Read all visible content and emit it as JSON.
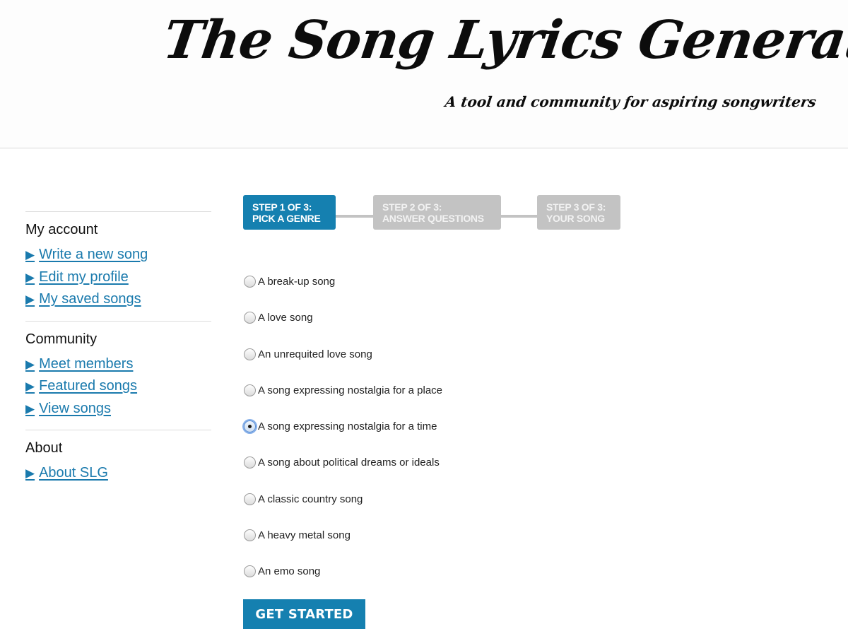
{
  "header": {
    "title": "The Song Lyrics Generator",
    "tagline": "A tool and community for aspiring songwriters"
  },
  "sidebar": {
    "link_icon": "▶",
    "sections": [
      {
        "heading": "My account",
        "links": [
          "Write a new song",
          "Edit my profile",
          "My saved songs"
        ]
      },
      {
        "heading": "Community",
        "links": [
          "Meet members",
          "Featured songs",
          "View songs"
        ]
      },
      {
        "heading": "About",
        "links": [
          "About SLG"
        ]
      }
    ]
  },
  "steps": [
    {
      "line1": "STEP 1 OF 3:",
      "line2": "PICK A GENRE",
      "active": true
    },
    {
      "line1": "STEP 2 OF 3:",
      "line2": "ANSWER QUESTIONS",
      "active": false
    },
    {
      "line1": "STEP 3 OF 3:",
      "line2": "YOUR SONG",
      "active": false
    }
  ],
  "genres": {
    "selected_index": 4,
    "options": [
      "A break-up song",
      "A love song",
      "An unrequited love song",
      "A song expressing nostalgia for a place",
      "A song expressing nostalgia for a time",
      "A song about political dreams or ideals",
      "A classic country song",
      "A heavy metal song",
      "An emo song"
    ]
  },
  "actions": {
    "get_started_label": "GET STARTED"
  },
  "colors": {
    "accent": "#1580b0",
    "link": "#1a7aad",
    "step_inactive": "#c3c3c3"
  }
}
